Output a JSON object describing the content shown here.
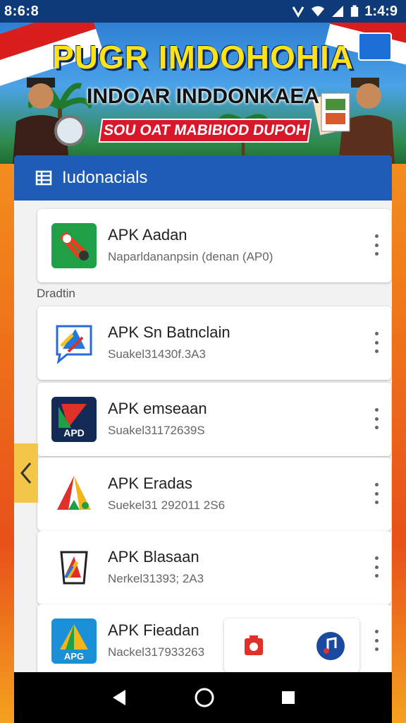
{
  "status_bar": {
    "time_left": "8:6:8",
    "time_right": "1:4:9",
    "icons": [
      "data-saver-icon",
      "wifi-icon",
      "signal-icon",
      "battery-icon"
    ]
  },
  "banner": {
    "title": "PUGR IMDOHOHIA",
    "subtitle": "INDOAR INDDONKAEA",
    "tagline": "SOU OAT MABIBIOD DUPOH"
  },
  "panel": {
    "header_icon": "list-icon",
    "header_title": "Iudonacials",
    "section_label": "Dradtin"
  },
  "apps": [
    {
      "name": "APK Aadan",
      "sub": "Naparldananpsin (denan (AP0)",
      "icon": "green-arrow-app-icon"
    },
    {
      "name": "APK Sn Batnclain",
      "sub": "Suakel31430f.3A3",
      "icon": "blue-chat-app-icon"
    },
    {
      "name": "APK emseaan",
      "sub": "Suakel31172639S",
      "icon": "apd-play-app-icon"
    },
    {
      "name": "APK Eradas",
      "sub": "Suekel31 292011 2S6",
      "icon": "triangle-app-icon"
    },
    {
      "name": "APK Blasaan",
      "sub": "Nerkel31393; 2A3",
      "icon": "bag-app-icon"
    },
    {
      "name": "APK Fieadan",
      "sub": "Nackel317933263",
      "icon": "apg-play-app-icon"
    }
  ],
  "nav": {
    "back": "back-icon",
    "home": "home-icon",
    "recents": "recents-icon"
  },
  "colors": {
    "status_bar": "#0e3a78",
    "header": "#1e5cb8",
    "accent_yellow": "#ffe21a",
    "banner_red": "#d8182a"
  }
}
